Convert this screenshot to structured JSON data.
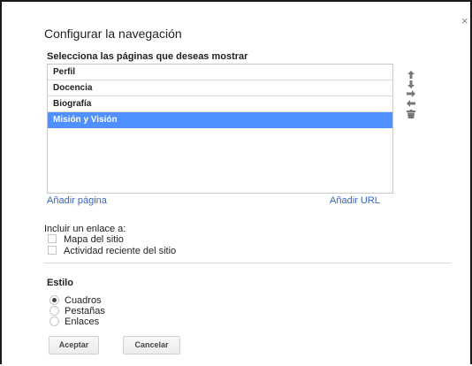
{
  "dialog": {
    "title": "Configurar la navegación",
    "close_glyph": "×"
  },
  "pages": {
    "heading": "Selecciona las páginas que deseas mostrar",
    "items": [
      {
        "label": "Perfil",
        "selected": false
      },
      {
        "label": "Docencia",
        "selected": false
      },
      {
        "label": "Biografía",
        "selected": false
      },
      {
        "label": "Misión y Visión",
        "selected": true
      }
    ],
    "add_page_link": "Añadir página",
    "add_url_link": "Añadir URL",
    "controls": [
      "arrow-up-icon",
      "arrow-down-icon",
      "arrow-right-icon",
      "arrow-left-icon",
      "trash-icon"
    ]
  },
  "include": {
    "label": "Incluir un enlace a:",
    "options": [
      {
        "label": "Mapa del sitio",
        "checked": false
      },
      {
        "label": "Actividad reciente del sitio",
        "checked": false
      }
    ]
  },
  "style": {
    "heading": "Estilo",
    "options": [
      {
        "label": "Cuadros",
        "selected": true
      },
      {
        "label": "Pestañas",
        "selected": false
      },
      {
        "label": "Enlaces",
        "selected": false
      }
    ]
  },
  "buttons": {
    "ok": "Aceptar",
    "cancel": "Cancelar"
  },
  "colors": {
    "selection": "#4d90fe",
    "link": "#3366cc"
  }
}
